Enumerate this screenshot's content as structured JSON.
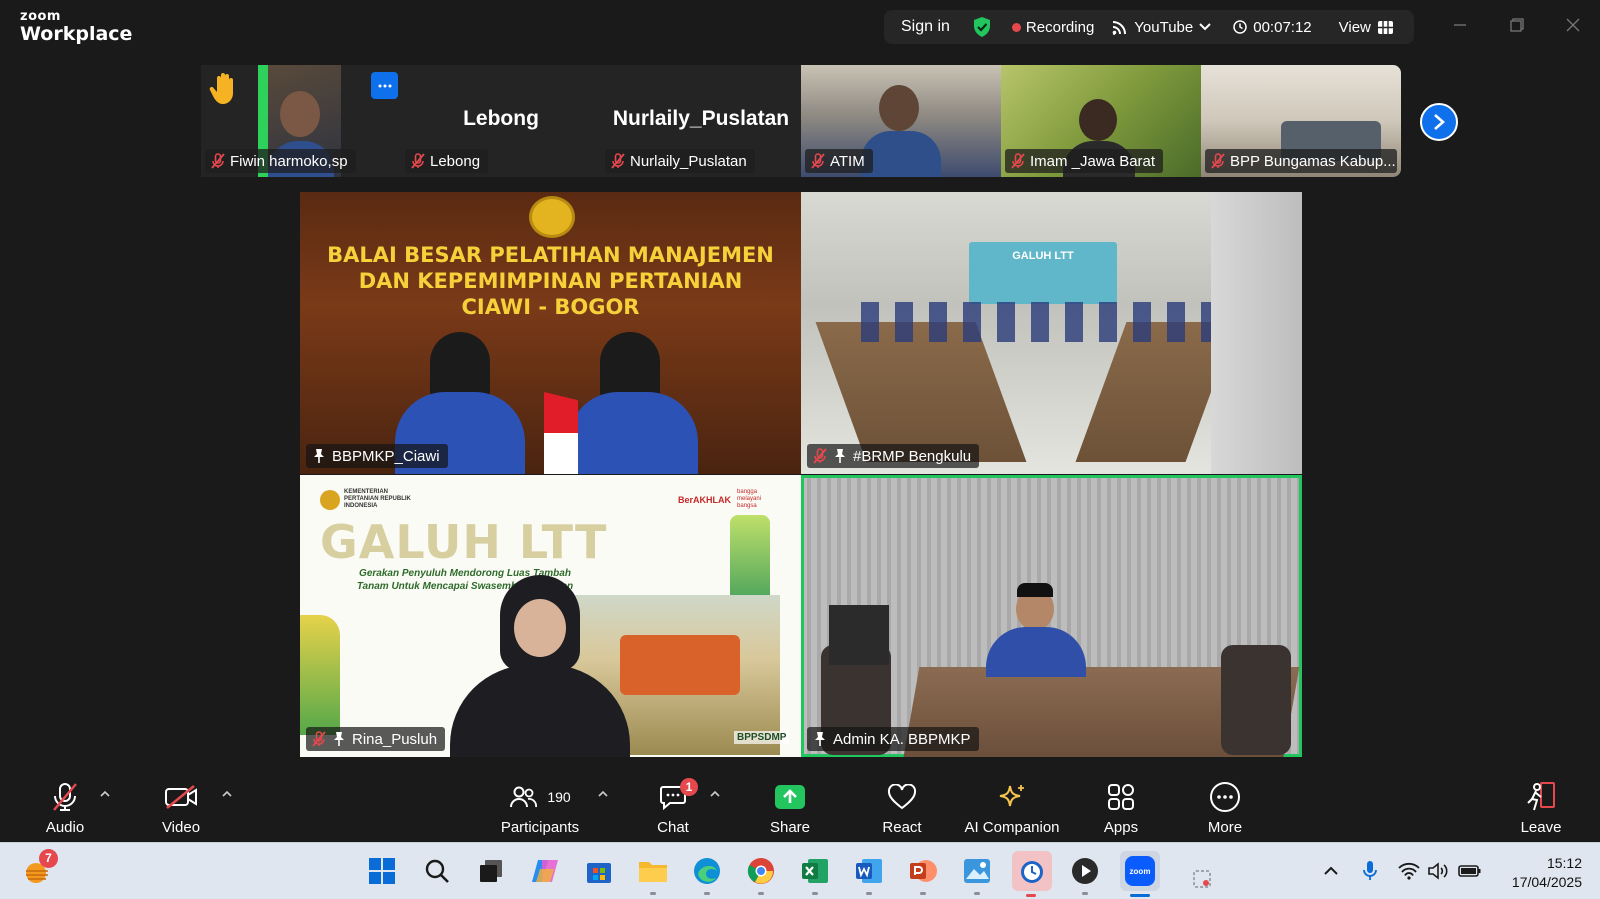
{
  "app": {
    "logo_line1": "zoom",
    "logo_line2": "Workplace"
  },
  "meeting_bar": {
    "sign_in": "Sign in",
    "recording": "Recording",
    "stream": "YouTube",
    "timer": "00:07:12",
    "view": "View"
  },
  "thumbnails": [
    {
      "name": "Fiwin harmoko,sp",
      "big_name": ""
    },
    {
      "name": "Lebong",
      "big_name": "Lebong"
    },
    {
      "name": "Nurlaily_Puslatan",
      "big_name": "Nurlaily_Puslatan"
    },
    {
      "name": "ATIM",
      "big_name": ""
    },
    {
      "name": "Imam _Jawa Barat",
      "big_name": ""
    },
    {
      "name": "BPP Bungamas Kabup...",
      "big_name": ""
    }
  ],
  "tiles": [
    {
      "name": "BBPMKP_Ciawi",
      "banner_line1": "BALAI BESAR PELATIHAN MANAJEMEN",
      "banner_line2": "DAN KEPEMIMPINAN PERTANIAN",
      "banner_line3": "CIAWI - BOGOR"
    },
    {
      "name": "#BRMP Bengkulu",
      "banner_text": "GALUH LTT"
    },
    {
      "name": "Rina_Pusluh",
      "ministry": "KEMENTERIAN PERTANIAN REPUBLIK INDONESIA",
      "brand": "BerAKHLAK",
      "brand2": "bangga melayani bangsa",
      "title": "GALUH LTT",
      "subtitle1": "Gerakan Penyuluh Mendorong Luas Tambah",
      "subtitle2": "Tanam Untuk Mencapai Swasembada Pangan",
      "watermark": "BPPSDMP"
    },
    {
      "name": "Admin KA. BBPMKP"
    }
  ],
  "toolbar": {
    "audio": "Audio",
    "video": "Video",
    "participants": "Participants",
    "participants_count": "190",
    "chat": "Chat",
    "chat_badge": "1",
    "share": "Share",
    "react": "React",
    "ai_companion": "AI Companion",
    "apps": "Apps",
    "more": "More",
    "leave": "Leave"
  },
  "taskbar": {
    "weather_badge": "7",
    "time": "15:12",
    "date": "17/04/2025",
    "zoom_label": "zoom"
  },
  "colors": {
    "accent_blue": "#0e71eb",
    "active_speaker": "#22c55e",
    "share_green": "#22c55e",
    "recording_red": "#e5484d"
  }
}
